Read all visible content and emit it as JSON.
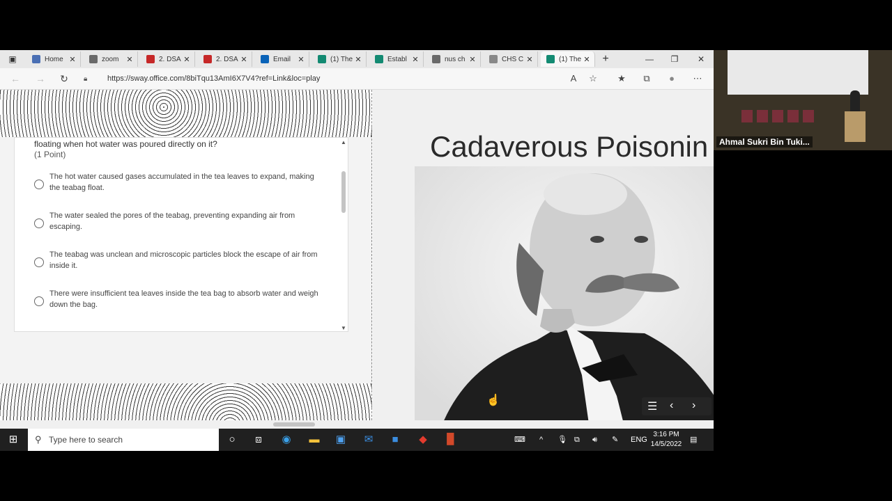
{
  "browser": {
    "tabs": [
      {
        "label": "Home",
        "icon": "onedrive-icon",
        "color": "#4a6fb4"
      },
      {
        "label": "zoom",
        "icon": "search-icon",
        "color": "#6a6a6a"
      },
      {
        "label": "2. DSA",
        "icon": "pdf-icon",
        "color": "#c62828"
      },
      {
        "label": "2. DSA",
        "icon": "pdf-icon",
        "color": "#c62828"
      },
      {
        "label": "Email",
        "icon": "outlook-icon",
        "color": "#0a63b8"
      },
      {
        "label": "(1) The",
        "icon": "sway-icon",
        "color": "#138a72"
      },
      {
        "label": "Establ",
        "icon": "sway-icon",
        "color": "#138a72"
      },
      {
        "label": "nus ch",
        "icon": "search-icon",
        "color": "#6a6a6a"
      },
      {
        "label": "CHS C",
        "icon": "page-icon",
        "color": "#888888"
      },
      {
        "label": "(1) The",
        "icon": "sway-icon",
        "color": "#138a72"
      }
    ],
    "url": "https://sway.office.com/8biTqu13AmI6X7V4?ref=Link&loc=play"
  },
  "form": {
    "question": "floating when hot water was poured directly on it?",
    "points": "(1 Point)",
    "options": [
      "The hot water caused gases accumulated in the tea leaves to expand, making the teabag float.",
      "The water sealed the pores of the teabag, preventing expanding air from escaping.",
      "The teabag was unclean and microscopic particles block the escape of air from inside it.",
      "There were insufficient tea leaves inside the tea bag to absorb water and weigh down the bag."
    ]
  },
  "slide": {
    "title": "Cadaverous Poisonin"
  },
  "taskbar": {
    "search_placeholder": "Type here to search",
    "language": "ENG",
    "time": "3:16 PM",
    "date": "14/5/2022"
  },
  "video": {
    "participant_name": "Ahmal Sukri Bin Tuki..."
  }
}
